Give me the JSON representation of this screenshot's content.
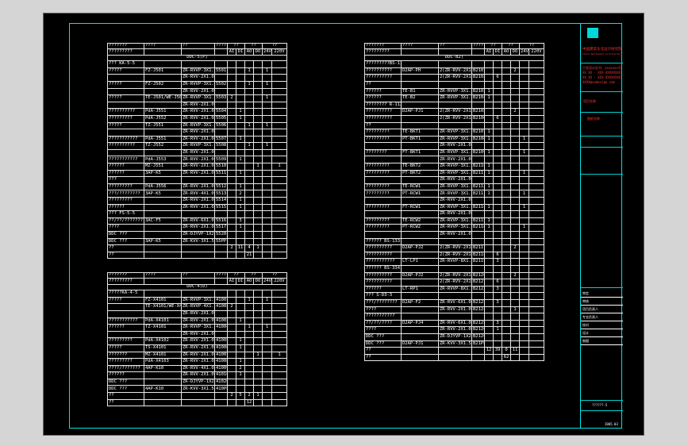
{
  "header": {
    "col_code": "???????",
    "col_name": "????",
    "col_model": "??",
    "col_no": "????",
    "col_points": "??",
    "col_points2": "??",
    "col_power": "??",
    "sub_code": "?????????",
    "sub_ai": "AI",
    "sub_di": "DI",
    "sub_ao": "AO",
    "sub_do": "DO",
    "sub_24v": "24V",
    "sub_220v": "220V"
  },
  "table1": {
    "title": "DDC-5(P)",
    "rows": [
      [
        "??? KA-5-5",
        "",
        "",
        "",
        "",
        "",
        "",
        "",
        "",
        ""
      ],
      [
        "?????",
        "FZ-J501",
        "ZR-RVVP-3X1.0",
        "5501",
        "",
        "",
        "1",
        "",
        "1",
        ""
      ],
      [
        "",
        "",
        "ZR-RVV-2X1.0",
        "",
        "",
        "",
        "",
        "",
        "",
        ""
      ],
      [
        "?????",
        "FZ-J502",
        "ZR-RVVP-3X1.0",
        "5502",
        "",
        "",
        "1",
        "",
        "1",
        ""
      ],
      [
        "",
        "",
        "ZR-RVV-2X1.0",
        "",
        "",
        "",
        "",
        "",
        "",
        ""
      ],
      [
        "?????",
        "TE-J501/WE-J501",
        "ZR-RVVP-3X1.0",
        "5503",
        "2",
        "",
        "",
        "",
        "1",
        ""
      ],
      [
        "",
        "",
        "ZR-RVV-2X1.0",
        "",
        "",
        "",
        "",
        "",
        "",
        ""
      ],
      [
        "??????????",
        "PdA-J551",
        "ZR-RVV-2X1.0",
        "5504",
        "",
        "1",
        "",
        "",
        "",
        ""
      ],
      [
        "?????????",
        "PdA-J552",
        "ZR-RVV-2X1.0",
        "5505",
        "",
        "1",
        "",
        "",
        "",
        ""
      ],
      [
        "?????",
        "TZ-J551",
        "ZR-RVVP-3X1.0",
        "5506",
        "",
        "",
        "1",
        "",
        "1",
        ""
      ],
      [
        "",
        "",
        "ZR-RVV-2X1.0",
        "",
        "",
        "",
        "",
        "",
        "",
        ""
      ],
      [
        "???????????",
        "PdA-J551",
        "ZR-RVV-2X1.0",
        "5507",
        "",
        "1",
        "",
        "",
        "",
        ""
      ],
      [
        "??????????",
        "TZ-J552",
        "ZR-RVVP-3X1.0",
        "5508",
        "",
        "",
        "1",
        "",
        "1",
        ""
      ],
      [
        "",
        "",
        "ZR-RVV-2X1.0",
        "",
        "",
        "",
        "",
        "",
        "",
        ""
      ],
      [
        "???????????",
        "PdA-J553",
        "ZR-RVV-2X1.0",
        "5509",
        "",
        "1",
        "",
        "",
        "",
        ""
      ],
      [
        "??????",
        "MZ-J551",
        "ZR-RVV-2X1.0",
        "5510",
        "",
        "",
        "",
        "1",
        "",
        "1"
      ],
      [
        "??????",
        "3AP-K5",
        "ZR-RVV-2X1.0",
        "5511",
        "",
        "1",
        "",
        "",
        "",
        ""
      ],
      [
        "???",
        "",
        "",
        "",
        "",
        "",
        "",
        "",
        "",
        ""
      ],
      [
        "?????????",
        "PdA-J556",
        "ZR-RVV-2X1.0",
        "5512",
        "",
        "1",
        "",
        "",
        "",
        ""
      ],
      [
        "???/????????",
        "3AP-K5",
        "ZR-RVV-4X1.0",
        "5513",
        "",
        "2",
        "",
        "",
        "",
        ""
      ],
      [
        "?????????",
        "",
        "ZR-RVV-2X1.0",
        "5514",
        "",
        "1",
        "",
        "",
        "",
        ""
      ],
      [
        "??????",
        "",
        "ZR-RVV-2X1.0",
        "5515",
        "",
        "1",
        "",
        "",
        "",
        ""
      ],
      [
        "??? FS-5-5",
        "",
        "",
        "",
        "",
        "",
        "",
        "",
        "",
        ""
      ],
      [
        "??/??/????????",
        "3AC-F5",
        "ZR-RVV-6X1.0",
        "5516",
        "",
        "3",
        "",
        "",
        "",
        ""
      ],
      [
        "????",
        "",
        "ZR-RVV-2X1.0",
        "5517",
        "",
        "1",
        "",
        "",
        "",
        ""
      ],
      [
        "DDC ???",
        "",
        "ZR-DJYVP-1X2X1.0",
        "5520",
        "",
        "",
        "",
        "",
        "",
        ""
      ],
      [
        "DDC ???",
        "3AP-K5",
        "ZR-KVV-3X1.5",
        "55PP",
        "",
        "",
        "",
        "",
        "",
        ""
      ],
      [
        "??",
        "",
        "",
        "",
        "2",
        "11",
        "4",
        "1",
        "",
        ""
      ],
      [
        "??",
        "",
        "",
        "",
        "",
        "",
        "21",
        "",
        "",
        ""
      ]
    ]
  },
  "table2": {
    "title": "DDC-4(D)",
    "rows": [
      [
        "?????KA-4-5",
        "",
        "",
        "",
        "",
        "",
        "",
        "",
        "",
        ""
      ],
      [
        "?????",
        "FZ-X4101",
        "ZR-RVVP-3X1.0",
        "41001",
        "",
        "",
        "1",
        "",
        "1",
        ""
      ],
      [
        "",
        "TE-X4101/WE-X4101",
        "ZR-RVVP-4X1.0",
        "41002",
        "2",
        "",
        "",
        "",
        "",
        ""
      ],
      [
        "",
        "",
        "ZR-RVV-2X1.0",
        "",
        "",
        "",
        "",
        "",
        "",
        ""
      ],
      [
        "???????????",
        "PdA-X4101",
        "ZR-RVV-2X1.0",
        "41003",
        "",
        "1",
        "",
        "",
        "",
        ""
      ],
      [
        "??????",
        "TZ-X4101",
        "ZR-RVVP-3X1.0",
        "41004",
        "",
        "",
        "1",
        "",
        "1",
        ""
      ],
      [
        "",
        "",
        "ZR-RVV-2X1.0",
        "",
        "",
        "",
        "",
        "",
        "",
        ""
      ],
      [
        "?????????",
        "PdA-X4102",
        "ZR-RVV-2X1.0",
        "41005",
        "",
        "1",
        "",
        "",
        "",
        ""
      ],
      [
        "?????",
        "TS-X4101",
        "ZR-RVV-2X1.0",
        "41006",
        "",
        "1",
        "",
        "",
        "",
        ""
      ],
      [
        "???????",
        "MZ-X4101",
        "ZR-RVV-2X1.0",
        "41007",
        "",
        "",
        "",
        "1",
        "",
        "1"
      ],
      [
        "?????????",
        "PdA-X4103",
        "ZR-RVV-2X1.0",
        "41008",
        "",
        "1",
        "",
        "",
        "",
        ""
      ],
      [
        "????/???????",
        "4AP-K10",
        "ZR-RVV-4X1.0",
        "41009",
        "",
        "2",
        "",
        "",
        "",
        ""
      ],
      [
        "??????",
        "",
        "ZR-RVV-2X1.0",
        "41010",
        "",
        "1",
        "",
        "",
        "",
        ""
      ],
      [
        "DDC ???",
        "",
        "ZR-DJYVP-1X2X1.0",
        "41020",
        "",
        "",
        "",
        "",
        "",
        ""
      ],
      [
        "DDC ???",
        "4AP-K10",
        "ZR-KVV-3X1.5",
        "410PP",
        "",
        "",
        "",
        "",
        "",
        ""
      ],
      [
        "??",
        "",
        "",
        "",
        "2",
        "5",
        "2",
        "1",
        "",
        ""
      ],
      [
        "??",
        "",
        "",
        "",
        "",
        "",
        "12",
        "",
        "",
        ""
      ]
    ]
  },
  "table3": {
    "title": "DDC-B2)",
    "rows": [
      [
        "?????????BS-112",
        "",
        "",
        "",
        "",
        "",
        "",
        "",
        "",
        ""
      ],
      [
        "??????????",
        "D2AP-PH",
        "2(ZR-RVV-2X1.0)",
        "B2101",
        "",
        "",
        "",
        "2",
        "",
        ""
      ],
      [
        "??????????",
        "",
        "2(ZR-RVV-2X1.0)",
        "B2102",
        "",
        "6",
        "",
        "",
        "",
        ""
      ],
      [
        "??",
        "",
        "",
        "",
        "",
        "",
        "",
        "",
        "",
        ""
      ],
      [
        "??????",
        "TE-B1",
        "ZR-RVVP-3X1.0",
        "B2103",
        "1",
        "",
        "",
        "",
        "",
        ""
      ],
      [
        "??????",
        "TE-B2",
        "ZR-RVVP-3X1.0",
        "B2104",
        "1",
        "",
        "",
        "",
        "",
        ""
      ],
      [
        "???????? R-112",
        "",
        "",
        "",
        "",
        "",
        "",
        "",
        "",
        ""
      ],
      [
        "??????????",
        "D2AP-PJ1",
        "2(ZR-RVV-2X1.0)",
        "B2105",
        "",
        "",
        "",
        "2",
        "",
        ""
      ],
      [
        "??????????",
        "",
        "2(ZR-RVV-2X1.0)",
        "B2106",
        "",
        "6",
        "",
        "",
        "",
        ""
      ],
      [
        "??",
        "",
        "",
        "",
        "",
        "",
        "",
        "",
        "",
        ""
      ],
      [
        "?????????",
        "TE-BKT1",
        "ZR-RVVP-3X1.0",
        "B2107",
        "1",
        "",
        "",
        "",
        "",
        ""
      ],
      [
        "?????????",
        "PT-BKT1",
        "ZR-RVVP-3X1.0",
        "B2108",
        "1",
        "",
        "",
        "",
        "1",
        ""
      ],
      [
        "",
        "",
        "ZR-RVV-2X1.0",
        "",
        "",
        "",
        "",
        "",
        "",
        ""
      ],
      [
        "????????",
        "FT-BKT1",
        "ZR-RVVP-3X1.0",
        "B2109",
        "1",
        "",
        "",
        "",
        "1",
        ""
      ],
      [
        "",
        "",
        "ZR-RVV-2X1.0",
        "",
        "",
        "",
        "",
        "",
        "",
        ""
      ],
      [
        "?????????",
        "TE-BKT2",
        "ZR-RVVP-3X1.0",
        "B2110",
        "1",
        "",
        "",
        "",
        "",
        ""
      ],
      [
        "?????????",
        "PT-BKT2",
        "ZR-RVVP-3X1.0",
        "B2111",
        "1",
        "",
        "",
        "",
        "1",
        ""
      ],
      [
        "",
        "",
        "ZR-RVV-2X1.0",
        "",
        "",
        "",
        "",
        "",
        "",
        ""
      ],
      [
        "?????????",
        "TE-RCW1",
        "ZR-RVVP-3X1.0",
        "B2112",
        "1",
        "",
        "",
        "",
        "",
        ""
      ],
      [
        "?????????",
        "PT-RCW1",
        "ZR-RVVP-3X1.0",
        "B2113",
        "1",
        "",
        "",
        "",
        "1",
        ""
      ],
      [
        "",
        "",
        "ZR-RVV-2X1.0",
        "",
        "",
        "",
        "",
        "",
        "",
        ""
      ],
      [
        "?????????",
        "FT-RCW1",
        "ZR-RVVP-3X1.0",
        "B2114",
        "1",
        "",
        "",
        "",
        "1",
        ""
      ],
      [
        "",
        "",
        "ZR-RVV-2X1.0",
        "",
        "",
        "",
        "",
        "",
        "",
        ""
      ],
      [
        "?????????",
        "TE-RCW2",
        "ZR-RVVP-3X1.0",
        "B2115",
        "1",
        "",
        "",
        "",
        "",
        ""
      ],
      [
        "?????????",
        "PT-RCW2",
        "ZR-RVVP-3X1.0",
        "B2116",
        "1",
        "",
        "",
        "",
        "1",
        ""
      ],
      [
        "",
        "",
        "ZR-RVV-2X1.0",
        "",
        "",
        "",
        "",
        "",
        "",
        ""
      ],
      [
        "?????? BS-133",
        "",
        "",
        "",
        "",
        "",
        "",
        "",
        "",
        ""
      ],
      [
        "??????????",
        "D2AP-PJ2",
        "2(ZR-RVV-2X1.0)",
        "B2117",
        "",
        "",
        "",
        "2",
        "",
        ""
      ],
      [
        "??????????",
        "",
        "2(ZR-RVV-2X1.0)",
        "B2118",
        "",
        "6",
        "",
        "",
        "",
        ""
      ],
      [
        "???????????",
        "LT-LP1",
        "ZR-RVVP-8X1.0",
        "B2119",
        "",
        "3",
        "",
        "",
        "",
        ""
      ],
      [
        "?????? BS-334",
        "",
        "",
        "",
        "",
        "",
        "",
        "",
        "",
        ""
      ],
      [
        "??????????",
        "D2AP-PJ2",
        "2(ZR-RVV-2X1.0)",
        "B2120",
        "",
        "",
        "",
        "2",
        "",
        ""
      ],
      [
        "??????????",
        "",
        "2(ZR-RVV-2X1.0)",
        "B2121",
        "",
        "6",
        "",
        "",
        "",
        ""
      ],
      [
        "??????",
        "LT-RP1",
        "ZR-RVVP-8X1.0",
        "B2122",
        "",
        "3",
        "",
        "",
        "",
        ""
      ],
      [
        "??? S-D3-3",
        "",
        "",
        "",
        "",
        "",
        "",
        "",
        "",
        ""
      ],
      [
        "???/????????",
        "D2AP-F2",
        "ZR-RVV-6X1.0",
        "B2123",
        "",
        "3",
        "",
        "",
        "",
        ""
      ],
      [
        "????",
        "",
        "ZR-RVV-2X1.0",
        "B2124",
        "",
        "",
        "",
        "1",
        "",
        ""
      ],
      [
        "???????????",
        "",
        "",
        "",
        "",
        "",
        "",
        "",
        "",
        ""
      ],
      [
        "??/??/????",
        "D2AP-PJ4",
        "ZR-RVV-6X1.0",
        "B2125",
        "",
        "3",
        "",
        "",
        "",
        ""
      ],
      [
        "????",
        "",
        "ZR-RVV-2X1.0",
        "B2126",
        "",
        "1",
        "",
        "",
        "",
        ""
      ],
      [
        "DDC ???",
        "",
        "ZR-DJYVP-1X2X1.0",
        "B2120",
        "",
        "",
        "",
        "",
        "",
        ""
      ],
      [
        "DDC ???",
        "D2AP-PJ1",
        "ZR-KVV-3X1.5",
        "B21PP",
        "",
        "",
        "",
        "",
        "",
        ""
      ],
      [
        "??",
        "",
        "",
        "",
        "12",
        "39",
        "0",
        "11",
        "",
        ""
      ],
      [
        "??",
        "",
        "",
        "",
        "",
        "",
        "62",
        "",
        "",
        ""
      ]
    ]
  },
  "title_block": {
    "company_cn": "中国建筑东北设计研究院",
    "company_en": "China Northeast Architectural Design & Research Institute",
    "license_lines": [
      "工程设计证书：xxxxxxx号",
      "XX XX · XXX-XXXXXXXX",
      "XX XX · XXX-XXXXXXXX",
      "XXXX@sudesign.com"
    ],
    "project_label": "项目名称",
    "drawing_label": "图纸名称",
    "row_labels": [
      "审定",
      "审核",
      "项目负责人",
      "专业负责人",
      "校对",
      "设计",
      "制图"
    ],
    "drawing_no": "??????-5",
    "date": "2005.03"
  }
}
